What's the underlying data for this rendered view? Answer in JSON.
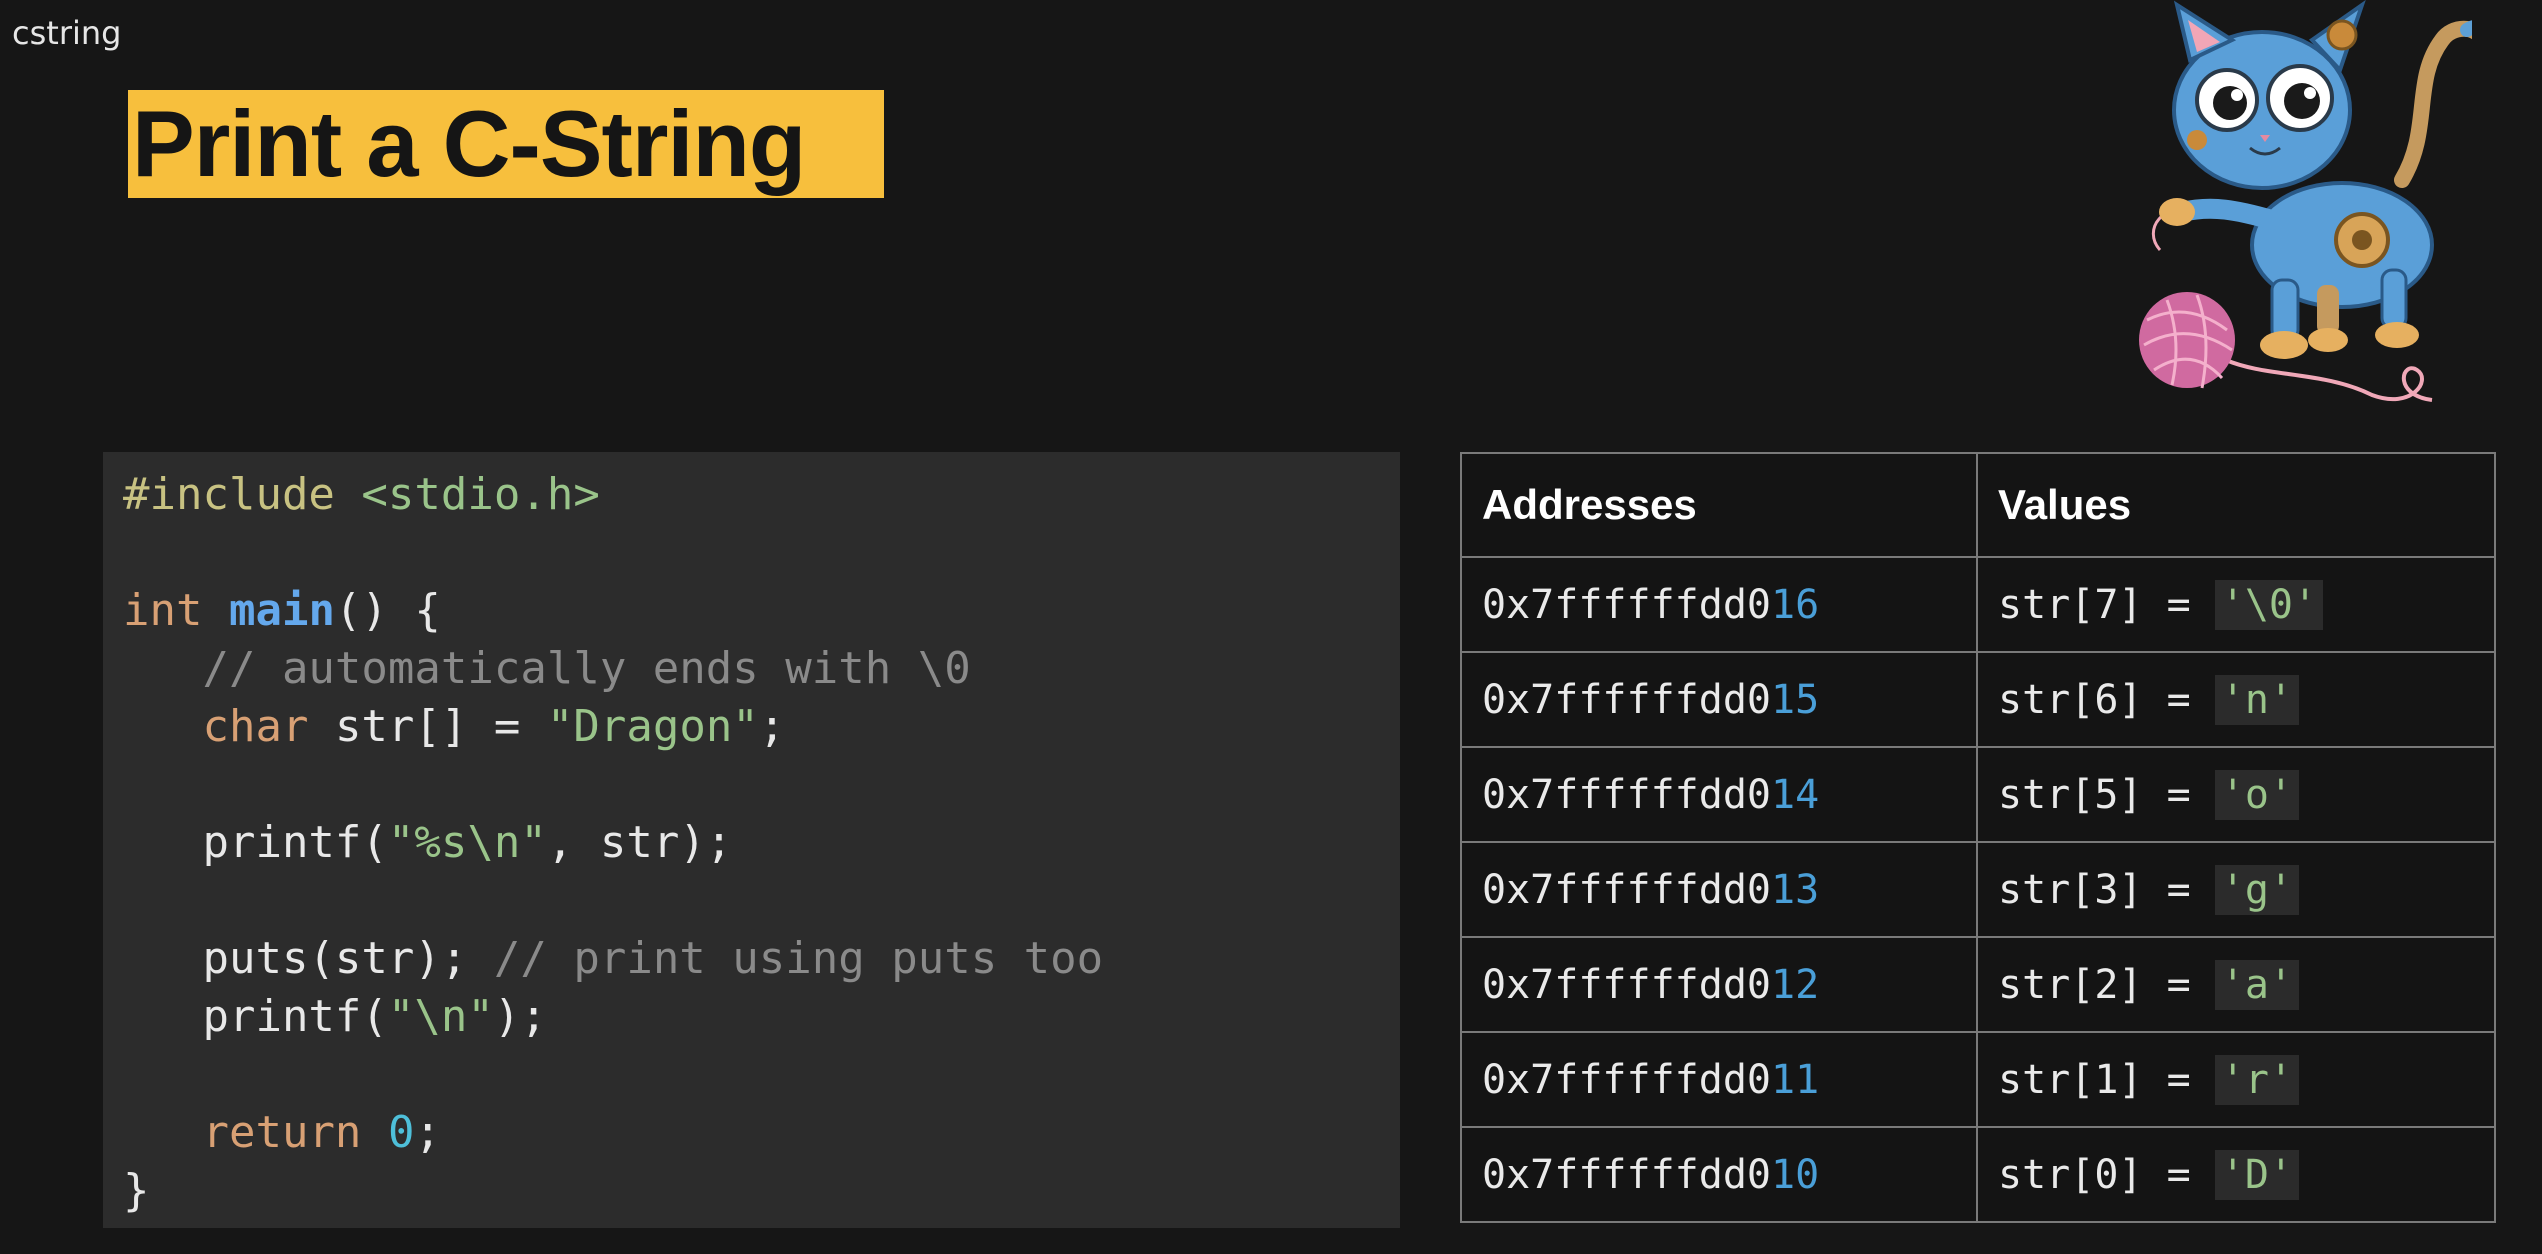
{
  "window": {
    "label": "cstring"
  },
  "slide": {
    "title": "Print a C-String"
  },
  "code": {
    "lines": [
      {
        "tokens": [
          {
            "t": "#include ",
            "c": "pre"
          },
          {
            "t": "<stdio.h>",
            "c": "str"
          }
        ]
      },
      {
        "tokens": [
          {
            "t": "int ",
            "c": "kw"
          },
          {
            "t": "main",
            "c": "fn"
          },
          {
            "t": "() {",
            "c": ""
          }
        ]
      },
      {
        "tokens": [
          {
            "t": "   // automatically ends with \\0",
            "c": "cm"
          }
        ]
      },
      {
        "tokens": [
          {
            "t": "   ",
            "c": ""
          },
          {
            "t": "char",
            "c": "kw"
          },
          {
            "t": " str[] = ",
            "c": ""
          },
          {
            "t": "\"Dragon\"",
            "c": "str"
          },
          {
            "t": ";",
            "c": ""
          }
        ]
      },
      {
        "tokens": [
          {
            "t": "   printf(",
            "c": ""
          },
          {
            "t": "\"%s\\n\"",
            "c": "str"
          },
          {
            "t": ", str);",
            "c": ""
          }
        ]
      },
      {
        "tokens": [
          {
            "t": "   puts(str); ",
            "c": ""
          },
          {
            "t": "// print using puts too",
            "c": "cm"
          }
        ]
      },
      {
        "tokens": [
          {
            "t": "   printf(",
            "c": ""
          },
          {
            "t": "\"\\n\"",
            "c": "str"
          },
          {
            "t": ");",
            "c": ""
          }
        ]
      },
      {
        "tokens": [
          {
            "t": "   ",
            "c": ""
          },
          {
            "t": "return",
            "c": "kw"
          },
          {
            "t": " ",
            "c": ""
          },
          {
            "t": "0",
            "c": "num"
          },
          {
            "t": ";",
            "c": ""
          }
        ]
      },
      {
        "tokens": [
          {
            "t": "}",
            "c": ""
          }
        ]
      }
    ]
  },
  "memory_table": {
    "headers": {
      "address": "Addresses",
      "value": "Values"
    },
    "rows": [
      {
        "addr_base": "0x7ffffffdd0",
        "addr_offset": "16",
        "value_prefix": "str[7] = ",
        "value_char": "'\\0'"
      },
      {
        "addr_base": "0x7ffffffdd0",
        "addr_offset": "15",
        "value_prefix": "str[6] = ",
        "value_char": "'n'"
      },
      {
        "addr_base": "0x7ffffffdd0",
        "addr_offset": "14",
        "value_prefix": "str[5] = ",
        "value_char": "'o'"
      },
      {
        "addr_base": "0x7ffffffdd0",
        "addr_offset": "13",
        "value_prefix": "str[3] = ",
        "value_char": "'g'"
      },
      {
        "addr_base": "0x7ffffffdd0",
        "addr_offset": "12",
        "value_prefix": "str[2] = ",
        "value_char": "'a'"
      },
      {
        "addr_base": "0x7ffffffdd0",
        "addr_offset": "11",
        "value_prefix": "str[1] = ",
        "value_char": "'r'"
      },
      {
        "addr_base": "0x7ffffffdd0",
        "addr_offset": "10",
        "value_prefix": "str[0] = ",
        "value_char": "'D'"
      }
    ]
  },
  "mascot": {
    "icon": "robot-cat-icon"
  }
}
